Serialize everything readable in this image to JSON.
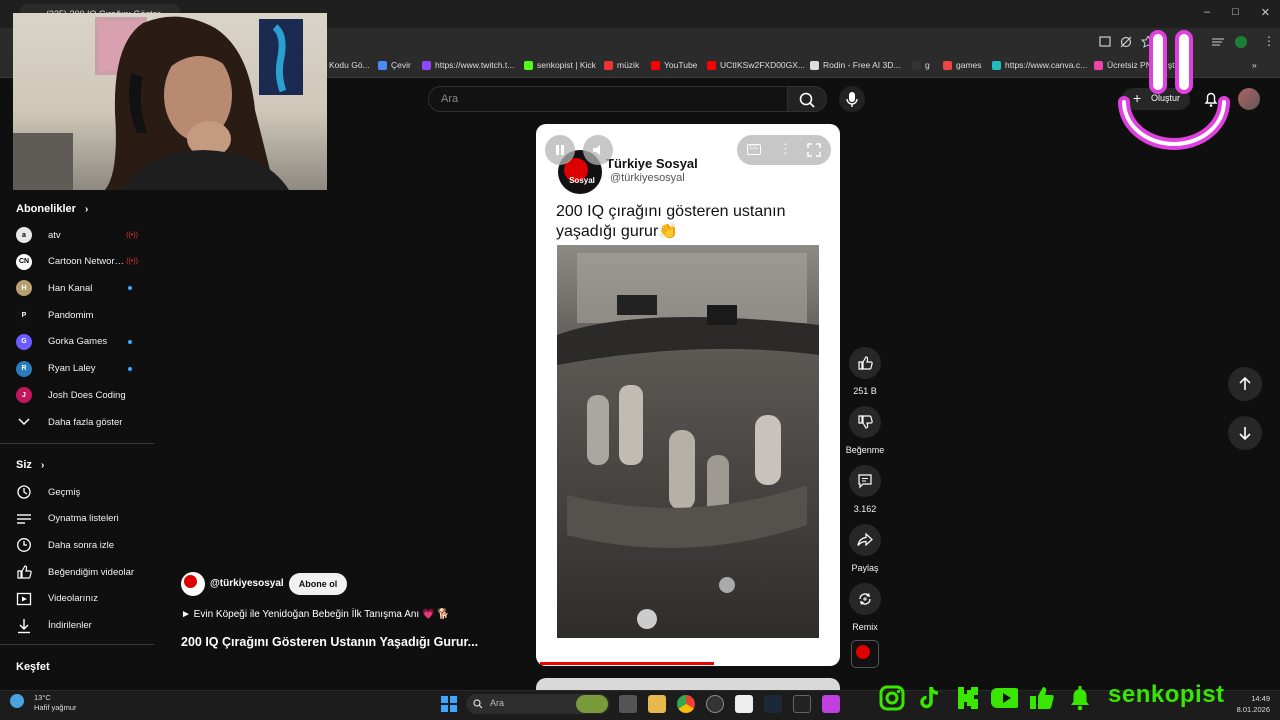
{
  "browser": {
    "tab_title": "(325) 200 IQ Çırağını Göster...",
    "bookmarks": [
      {
        "label": "Kodu Gö...",
        "color": "#888"
      },
      {
        "label": "Çevir",
        "color": "#4a8af4"
      },
      {
        "label": "https://www.twitch.t...",
        "color": "#9146ff"
      },
      {
        "label": "senkopist | Kick",
        "color": "#53fc18"
      },
      {
        "label": "müzik",
        "color": "#e33"
      },
      {
        "label": "YouTube",
        "color": "#f00"
      },
      {
        "label": "UCtIKSw2FXD00GX...",
        "color": "#f00"
      },
      {
        "label": "Rodin - Free AI 3D...",
        "color": "#ddd"
      },
      {
        "label": "g",
        "color": "#333"
      },
      {
        "label": "games",
        "color": "#e44"
      },
      {
        "label": "https://www.canva.c...",
        "color": "#2bb"
      },
      {
        "label": "Ücretsiz PNG ...ştu...",
        "color": "#e4a"
      }
    ]
  },
  "header": {
    "search_placeholder": "Ara",
    "create_label": "Oluştur"
  },
  "sidebar": {
    "subscriptions_title": "Abonelikler",
    "subscriptions": [
      {
        "name": "atv",
        "badge": "live",
        "color": "#e8e8e8",
        "initial": "a"
      },
      {
        "name": "Cartoon Network...",
        "badge": "live",
        "color": "#fff",
        "initial": "CN"
      },
      {
        "name": "Han Kanal",
        "badge": "dot",
        "color": "#b8a070",
        "initial": "H"
      },
      {
        "name": "Pandomim",
        "badge": "",
        "color": "#111",
        "initial": "P"
      },
      {
        "name": "Gorka Games",
        "badge": "dot",
        "color": "#6b5cff",
        "initial": "G"
      },
      {
        "name": "Ryan Laley",
        "badge": "dot",
        "color": "#2b7bbd",
        "initial": "R"
      },
      {
        "name": "Josh Does Coding",
        "badge": "",
        "color": "#c2185b",
        "initial": "J"
      }
    ],
    "show_more": "Daha fazla göster",
    "you_title": "Siz",
    "you_items": [
      {
        "name": "Geçmiş",
        "icon": "history-icon"
      },
      {
        "name": "Oynatma listeleri",
        "icon": "playlist-icon"
      },
      {
        "name": "Daha sonra izle",
        "icon": "clock-icon"
      },
      {
        "name": "Beğendiğim videolar",
        "icon": "thumbs-up-icon"
      },
      {
        "name": "Videolarınız",
        "icon": "video-icon"
      },
      {
        "name": "İndirilenler",
        "icon": "download-icon"
      }
    ],
    "explore_title": "Keşfet"
  },
  "short": {
    "account_name": "Türkiye Sosyal",
    "account_handle": "@türkiyesosyal",
    "caption": "200 IQ çırağını gösteren ustanın yaşadığı gurur👏",
    "avatar_text": "Sosyal",
    "progress": 0.58
  },
  "actions": {
    "likes": "251 B",
    "dislike_label": "Beğenme",
    "comments": "3.162",
    "share_label": "Paylaş",
    "remix_label": "Remix"
  },
  "channel": {
    "handle": "@türkiyesosyal",
    "subscribe_label": "Abone ol",
    "linked_video": "► Evin Köpeği ile Yenidoğan Bebeğin İlk Tanışma Anı 💗 🐕",
    "title": "200 IQ Çırağını Gösteren Ustanın Yaşadığı Gurur..."
  },
  "taskbar": {
    "temperature": "13°C",
    "weather": "Hafif yağmur",
    "search": "Ara",
    "time": "14:49",
    "date": "8.01.2026"
  },
  "overlay": {
    "streamer_handle": "senkopist",
    "accent": "#39e600"
  }
}
